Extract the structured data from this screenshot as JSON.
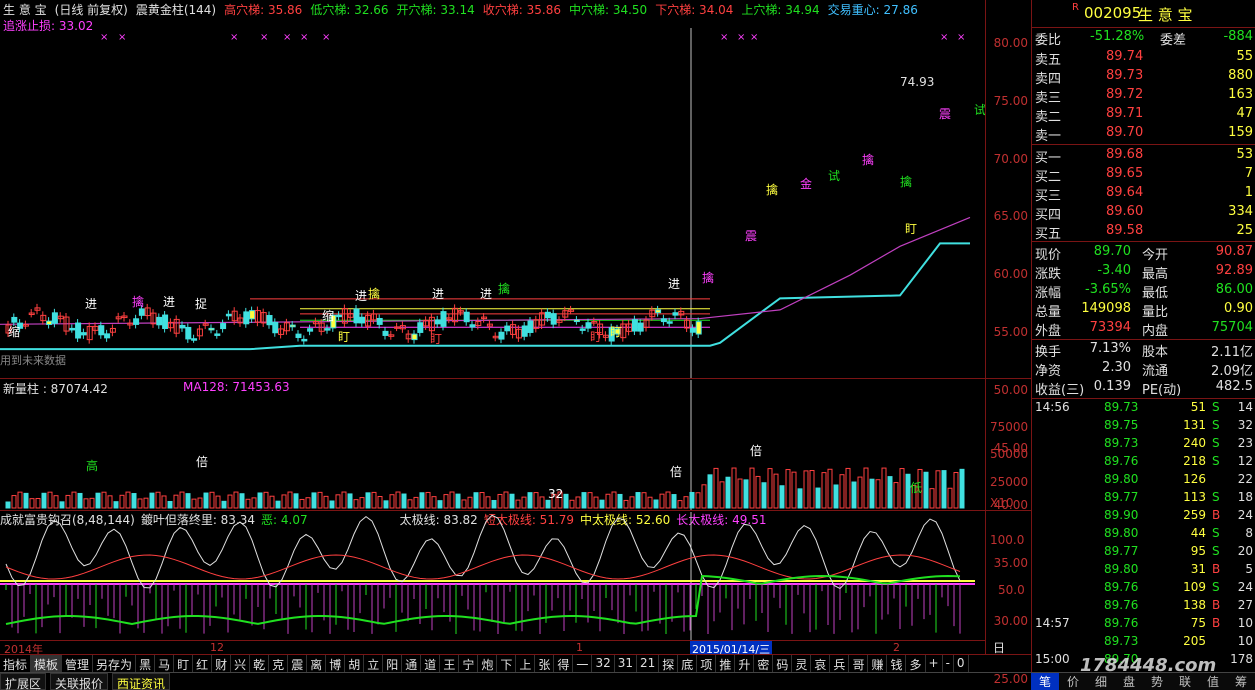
{
  "header": {
    "stock_name": "生 意 宝",
    "period": "(日线 前复权)",
    "indicator_name": "震黄金柱(144)",
    "items": [
      {
        "label": "高穴梯:",
        "value": "35.86",
        "color": "#ff4040"
      },
      {
        "label": "低穴梯:",
        "value": "32.66",
        "color": "#20e020"
      },
      {
        "label": "开穴梯:",
        "value": "33.14",
        "color": "#20e020"
      },
      {
        "label": "收穴梯:",
        "value": "35.86",
        "color": "#ff4040"
      },
      {
        "label": "中穴梯:",
        "value": "34.50",
        "color": "#20e020"
      },
      {
        "label": "下穴梯:",
        "value": "34.04",
        "color": "#ff4040"
      },
      {
        "label": "上穴梯:",
        "value": "34.94",
        "color": "#20e020"
      },
      {
        "label": "交易重心:",
        "value": "27.86",
        "color": "#40c0ff"
      }
    ],
    "stop_loss": "追涨止损: 33.02",
    "chart_note": "用到未来数据",
    "peak_label": "74.93"
  },
  "price_axis": [
    "80.00",
    "75.00",
    "70.00",
    "65.00",
    "60.00",
    "55.00",
    "50.00",
    "45.00",
    "40.00",
    "35.00",
    "30.00",
    "25.00"
  ],
  "volume": {
    "title": "新量柱 : 87074.42",
    "ma": "MA128: 71453.63",
    "axis": [
      "75000",
      "50000",
      "25000",
      "X10"
    ]
  },
  "indicator": {
    "title": "成就富贵钩召(8,48,144)",
    "title2": "鍍叶但落终里: 83.34",
    "e": "恶: 4.07",
    "big": "太极线: 83.82",
    "short": "短太极线: 51.79",
    "mid": "中太极线: 52.60",
    "long": "长太极线: 49.51",
    "axis": [
      "100.0",
      "50.0"
    ]
  },
  "timebar": {
    "y2014": "2014年",
    "m12": "12",
    "m1": "1",
    "m2": "2",
    "date": "2015/01/14/三",
    "period": "日线"
  },
  "quote": {
    "code_prefix": "R",
    "code": "002095",
    "name": "生 意 宝",
    "weibi_label": "委比",
    "weibi": "-51.28%",
    "weicha_label": "委差",
    "weicha": "-884",
    "asks": [
      {
        "label": "卖五",
        "price": "89.74",
        "vol": "55"
      },
      {
        "label": "卖四",
        "price": "89.73",
        "vol": "880"
      },
      {
        "label": "卖三",
        "price": "89.72",
        "vol": "163"
      },
      {
        "label": "卖二",
        "price": "89.71",
        "vol": "47"
      },
      {
        "label": "卖一",
        "price": "89.70",
        "vol": "159"
      }
    ],
    "bids": [
      {
        "label": "买一",
        "price": "89.68",
        "vol": "53"
      },
      {
        "label": "买二",
        "price": "89.65",
        "vol": "7"
      },
      {
        "label": "买三",
        "price": "89.64",
        "vol": "1"
      },
      {
        "label": "买四",
        "price": "89.60",
        "vol": "334"
      },
      {
        "label": "买五",
        "price": "89.58",
        "vol": "25"
      }
    ],
    "stats": [
      {
        "l1": "现价",
        "v1": "89.70",
        "c1": "#20e020",
        "l2": "今开",
        "v2": "90.87",
        "c2": "#ff4040"
      },
      {
        "l1": "涨跌",
        "v1": "-3.40",
        "c1": "#20e020",
        "l2": "最高",
        "v2": "92.89",
        "c2": "#ff4040"
      },
      {
        "l1": "涨幅",
        "v1": "-3.65%",
        "c1": "#20e020",
        "l2": "最低",
        "v2": "86.00",
        "c2": "#20e020"
      },
      {
        "l1": "总量",
        "v1": "149098",
        "c1": "#ffff40",
        "l2": "量比",
        "v2": "0.90",
        "c2": "#ffff40"
      },
      {
        "l1": "外盘",
        "v1": "73394",
        "c1": "#ff4040",
        "l2": "内盘",
        "v2": "75704",
        "c2": "#20e020"
      }
    ],
    "stats2": [
      {
        "l1": "换手",
        "v1": "7.13%",
        "l2": "股本",
        "v2": "2.11亿"
      },
      {
        "l1": "净资",
        "v1": "2.30",
        "l2": "流通",
        "v2": "2.09亿"
      },
      {
        "l1": "收益(三)",
        "v1": "0.139",
        "l2": "PE(动)",
        "v2": "482.5"
      }
    ],
    "ticks": [
      {
        "t": "14:56",
        "p": "89.73",
        "v": "51",
        "bs": "S",
        "n": "14"
      },
      {
        "t": "",
        "p": "89.75",
        "v": "131",
        "bs": "S",
        "n": "32"
      },
      {
        "t": "",
        "p": "89.73",
        "v": "240",
        "bs": "S",
        "n": "23"
      },
      {
        "t": "",
        "p": "89.76",
        "v": "218",
        "bs": "S",
        "n": "12"
      },
      {
        "t": "",
        "p": "89.80",
        "v": "126",
        "bs": "",
        "n": "22"
      },
      {
        "t": "",
        "p": "89.77",
        "v": "113",
        "bs": "S",
        "n": "18"
      },
      {
        "t": "",
        "p": "89.90",
        "v": "259",
        "bs": "B",
        "n": "24"
      },
      {
        "t": "",
        "p": "89.80",
        "v": "44",
        "bs": "S",
        "n": "8"
      },
      {
        "t": "",
        "p": "89.77",
        "v": "95",
        "bs": "S",
        "n": "20"
      },
      {
        "t": "",
        "p": "89.80",
        "v": "31",
        "bs": "B",
        "n": "5"
      },
      {
        "t": "",
        "p": "89.76",
        "v": "109",
        "bs": "S",
        "n": "24"
      },
      {
        "t": "",
        "p": "89.76",
        "v": "138",
        "bs": "B",
        "n": "27"
      },
      {
        "t": "14:57",
        "p": "89.76",
        "v": "75",
        "bs": "B",
        "n": "10"
      },
      {
        "t": "",
        "p": "89.73",
        "v": "205",
        "bs": "",
        "n": "10"
      },
      {
        "t": "15:00",
        "p": "89.70",
        "v": "",
        "bs": "",
        "n": "178"
      }
    ]
  },
  "toolbar": [
    "指标",
    "模板",
    "管理",
    "另存为",
    "黑",
    "马",
    "盯",
    "红",
    "财",
    "兴",
    "乾",
    "克",
    "震",
    "离",
    "博",
    "胡",
    "立",
    "阳",
    "通",
    "道",
    "王",
    "宁",
    "炮",
    "下",
    "上",
    "张",
    "得",
    "一",
    "32",
    "31",
    "21",
    "探",
    "底",
    "项",
    "推",
    "升",
    "密",
    "码",
    "灵",
    "哀",
    "兵",
    "哥",
    "赚",
    "钱",
    "多",
    "+",
    "-",
    "0"
  ],
  "status": [
    "扩展区",
    "关联报价",
    "西证资讯"
  ],
  "right_tabs": [
    "笔",
    "价",
    "细",
    "盘",
    "势",
    "联",
    "值",
    "筹"
  ],
  "watermark": "1784448.com"
}
